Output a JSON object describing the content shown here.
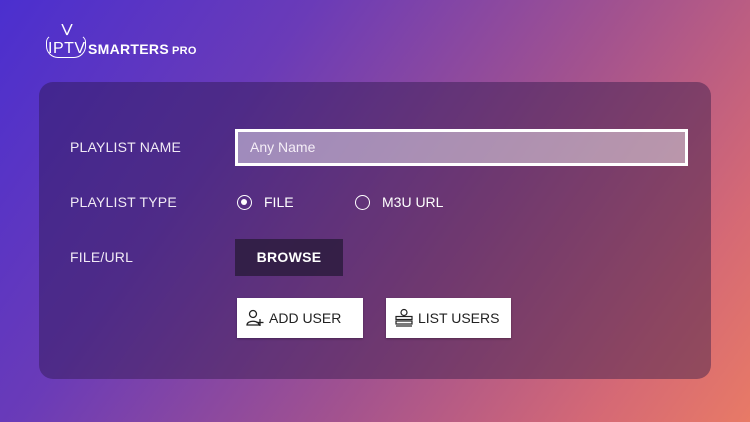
{
  "brand": {
    "prefix": "IPTV",
    "name": "SMARTERS",
    "suffix": "PRO"
  },
  "form": {
    "playlist_name_label": "PLAYLIST NAME",
    "playlist_name_placeholder": "Any Name",
    "playlist_type_label": "PLAYLIST TYPE",
    "type_options": [
      {
        "label": "FILE",
        "selected": true
      },
      {
        "label": "M3U URL",
        "selected": false
      }
    ],
    "file_url_label": "FILE/URL",
    "browse_label": "BROWSE"
  },
  "actions": {
    "add_user": {
      "label": "ADD USER",
      "icon": "add-user-icon"
    },
    "list_users": {
      "label": "LIST USERS",
      "icon": "list-users-icon"
    }
  }
}
